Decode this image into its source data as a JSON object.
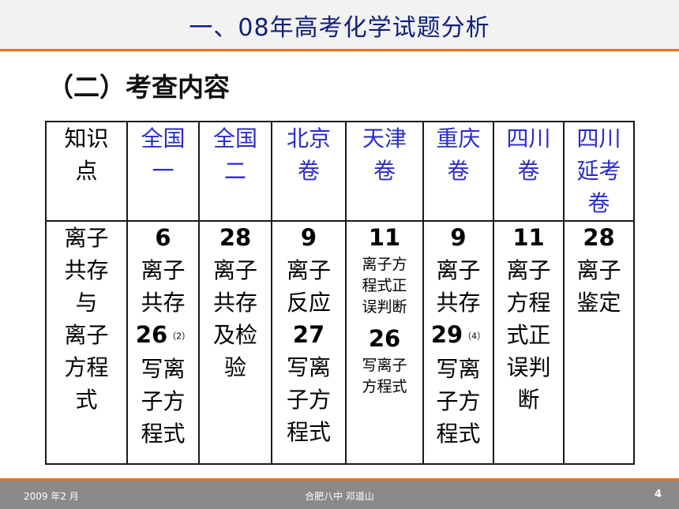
{
  "header": {
    "title": "一、08年高考化学试题分析"
  },
  "subtitle": "（二）考查内容",
  "table": {
    "columns": [
      {
        "label_lines": [
          "知识",
          "点"
        ]
      },
      {
        "label_lines": [
          "全国",
          "一"
        ]
      },
      {
        "label_lines": [
          "全国",
          "二"
        ]
      },
      {
        "label_lines": [
          "北京",
          "卷"
        ]
      },
      {
        "label_lines": [
          "天津",
          "卷"
        ]
      },
      {
        "label_lines": [
          "重庆",
          "卷"
        ]
      },
      {
        "label_lines": [
          "四川",
          "卷"
        ]
      },
      {
        "label_lines": [
          "四川",
          "延考",
          "卷"
        ]
      }
    ],
    "row": {
      "topic_lines": [
        "离子",
        "共存",
        "与",
        "离子",
        "方程",
        "式"
      ],
      "cells": [
        {
          "a_num": "6",
          "a_text": [
            "离子",
            "共存"
          ],
          "b_num": "26",
          "b_note": "（2）",
          "b_text": [
            "写离",
            "子方",
            "程式"
          ]
        },
        {
          "a_num": "28",
          "a_text": [
            "离子",
            "共存",
            "及检",
            "验"
          ]
        },
        {
          "a_num": "9",
          "a_text": [
            "离子",
            "反应"
          ],
          "b_num": "27",
          "b_text": [
            "写离",
            "子方",
            "程式"
          ]
        },
        {
          "a_num": "11",
          "a_text": [
            "离子方",
            "程式正",
            "误判断"
          ],
          "b_num": "26",
          "b_text": [
            "写离子",
            "方程式"
          ]
        },
        {
          "a_num": "9",
          "a_text": [
            "离子",
            "共存"
          ],
          "b_num": "29",
          "b_note": "（4）",
          "b_text": [
            "写离",
            "子方",
            "程式"
          ]
        },
        {
          "a_num": "11",
          "a_text": [
            "离子",
            "方程",
            "式正",
            "误判",
            "断"
          ]
        },
        {
          "a_num": "28",
          "a_text": [
            "离子",
            "鉴定"
          ]
        }
      ]
    }
  },
  "footer": {
    "date": "2009 年2 月",
    "author": "合肥八中 邓道山",
    "page": "4"
  }
}
